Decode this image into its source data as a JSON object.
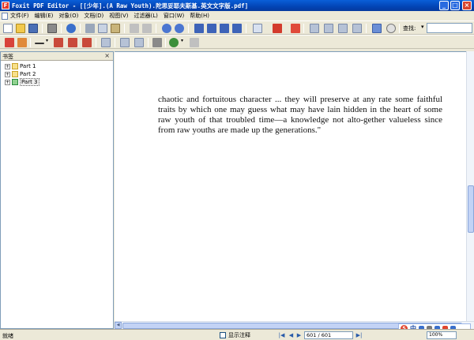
{
  "window": {
    "title": "Foxit PDF Editor - [[少年].(A Raw Youth).陀思妥耶夫斯基.英文文字版.pdf]",
    "min_label": "_",
    "max_label": "□",
    "close_label": "×"
  },
  "menu": {
    "items": [
      "文件(F)",
      "编辑(E)",
      "对象(O)",
      "文档(D)",
      "视图(V)",
      "过滤器(L)",
      "窗口(W)",
      "帮助(H)"
    ]
  },
  "toolbar": {
    "find_label": "查找:",
    "find_value": "",
    "find_arrow": "▾"
  },
  "bookmarks": {
    "tab_label": "书签",
    "close_label": "×",
    "items": [
      {
        "label": "Part 1",
        "expander": "+"
      },
      {
        "label": "Part 2",
        "expander": "+"
      },
      {
        "label": "Part 3",
        "expander": "+"
      }
    ]
  },
  "document": {
    "text": "chaotic and fortuitous character ... they will preserve at any rate some faithful traits by which one may guess what may have lain hidden in the heart of some raw youth of that troubled time—a knowledge not alto-gether valueless since from raw youths are made up the generations.\""
  },
  "statusbar": {
    "status": "就绪",
    "checkbox_label": "显示注释",
    "page_indicator": "601 / 601",
    "zoom": "100%",
    "nav_first": "|◀",
    "nav_prev": "◀",
    "nav_next": "▶",
    "nav_last": "▶|"
  },
  "ime": {
    "logo": "S",
    "mode": "中"
  },
  "colors": {
    "titlebar": "#0A5FD9",
    "chrome": "#ECE9D8",
    "border": "#7F9DB9"
  }
}
